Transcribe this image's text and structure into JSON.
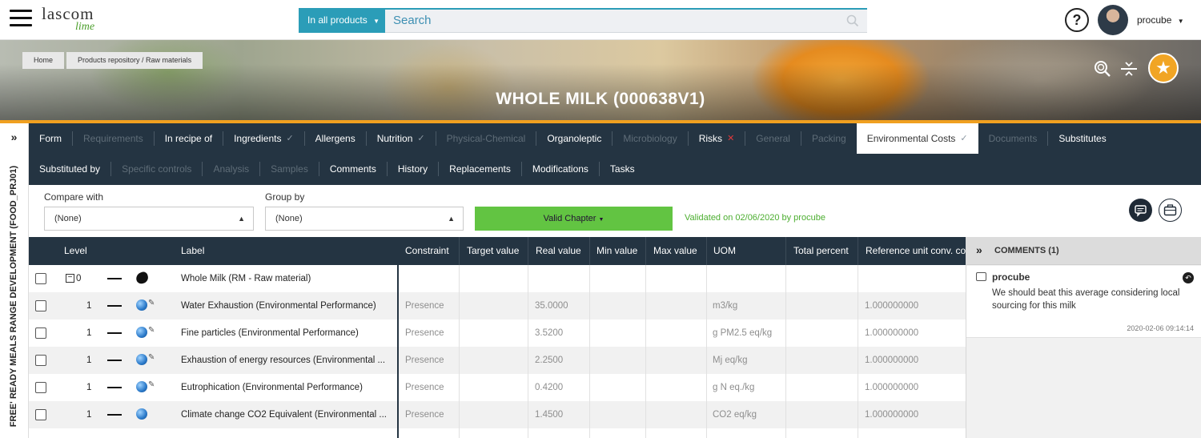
{
  "app": {
    "logo_top": "lascom",
    "logo_bottom": "lime"
  },
  "search": {
    "scope_label": "In all products",
    "placeholder": "Search"
  },
  "user": {
    "name": "procube"
  },
  "breadcrumb": [
    "Home",
    "Products repository / Raw materials"
  ],
  "page_title": "WHOLE MILK (000638V1)",
  "side_rail": {
    "text": "FREE' READY MEALS RANGE DEVELOPMENT (FOOD_PRJ01)"
  },
  "tabs_row1": [
    {
      "label": "Form",
      "state": "normal"
    },
    {
      "label": "Requirements",
      "state": "dim"
    },
    {
      "label": "In recipe of",
      "state": "normal"
    },
    {
      "label": "Ingredients",
      "state": "normal",
      "mark": "check"
    },
    {
      "label": "Allergens",
      "state": "normal"
    },
    {
      "label": "Nutrition",
      "state": "normal",
      "mark": "check"
    },
    {
      "label": "Physical-Chemical",
      "state": "dim"
    },
    {
      "label": "Organoleptic",
      "state": "normal"
    },
    {
      "label": "Microbiology",
      "state": "dim"
    },
    {
      "label": "Risks",
      "state": "normal",
      "mark": "x"
    },
    {
      "label": "General",
      "state": "dim"
    },
    {
      "label": "Packing",
      "state": "dim"
    },
    {
      "label": "Environmental Costs",
      "state": "active",
      "mark": "check"
    },
    {
      "label": "Documents",
      "state": "dim"
    },
    {
      "label": "Substitutes",
      "state": "normal"
    }
  ],
  "tabs_row2": [
    {
      "label": "Substituted by",
      "state": "normal"
    },
    {
      "label": "Specific controls",
      "state": "dim"
    },
    {
      "label": "Analysis",
      "state": "dim"
    },
    {
      "label": "Samples",
      "state": "dim"
    },
    {
      "label": "Comments",
      "state": "normal"
    },
    {
      "label": "History",
      "state": "normal"
    },
    {
      "label": "Replacements",
      "state": "normal"
    },
    {
      "label": "Modifications",
      "state": "normal"
    },
    {
      "label": "Tasks",
      "state": "normal"
    }
  ],
  "filters": {
    "compare_label": "Compare with",
    "compare_value": "(None)",
    "group_label": "Group by",
    "group_value": "(None)",
    "valid_button": "Valid Chapter",
    "validated_text": "Validated on 02/06/2020 by procube"
  },
  "table": {
    "headers": {
      "level": "Level",
      "label": "Label",
      "constraint": "Constraint",
      "target": "Target value",
      "real": "Real value",
      "min": "Min value",
      "max": "Max value",
      "uom": "UOM",
      "total": "Total percent",
      "ref": "Reference unit conv. coef."
    },
    "rows": [
      {
        "level": "0",
        "label": "Whole Milk (RM - Raw material)",
        "constraint": "",
        "real": "",
        "uom": "",
        "ref": ""
      },
      {
        "level": "1",
        "label": "Water Exhaustion (Environmental Performance)",
        "constraint": "Presence",
        "real": "35.0000",
        "uom": "m3/kg",
        "ref": "1.000000000"
      },
      {
        "level": "1",
        "label": "Fine particles (Environmental Performance)",
        "constraint": "Presence",
        "real": "3.5200",
        "uom": "g PM2.5 eq/kg",
        "ref": "1.000000000"
      },
      {
        "level": "1",
        "label": "Exhaustion of energy resources (Environmental ...",
        "constraint": "Presence",
        "real": "2.2500",
        "uom": "Mj eq/kg",
        "ref": "1.000000000"
      },
      {
        "level": "1",
        "label": "Eutrophication (Environmental Performance)",
        "constraint": "Presence",
        "real": "0.4200",
        "uom": "g N eq./kg",
        "ref": "1.000000000"
      },
      {
        "level": "1",
        "label": "Climate change CO2 Equivalent (Environmental ...",
        "constraint": "Presence",
        "real": "1.4500",
        "uom": "CO2 eq/kg",
        "ref": "1.000000000"
      }
    ]
  },
  "comments": {
    "title": "COMMENTS (1)",
    "items": [
      {
        "author": "procube",
        "text": "We should beat this average considering local sourcing for this milk",
        "date": "2020-02-06 09:14:14"
      }
    ]
  }
}
